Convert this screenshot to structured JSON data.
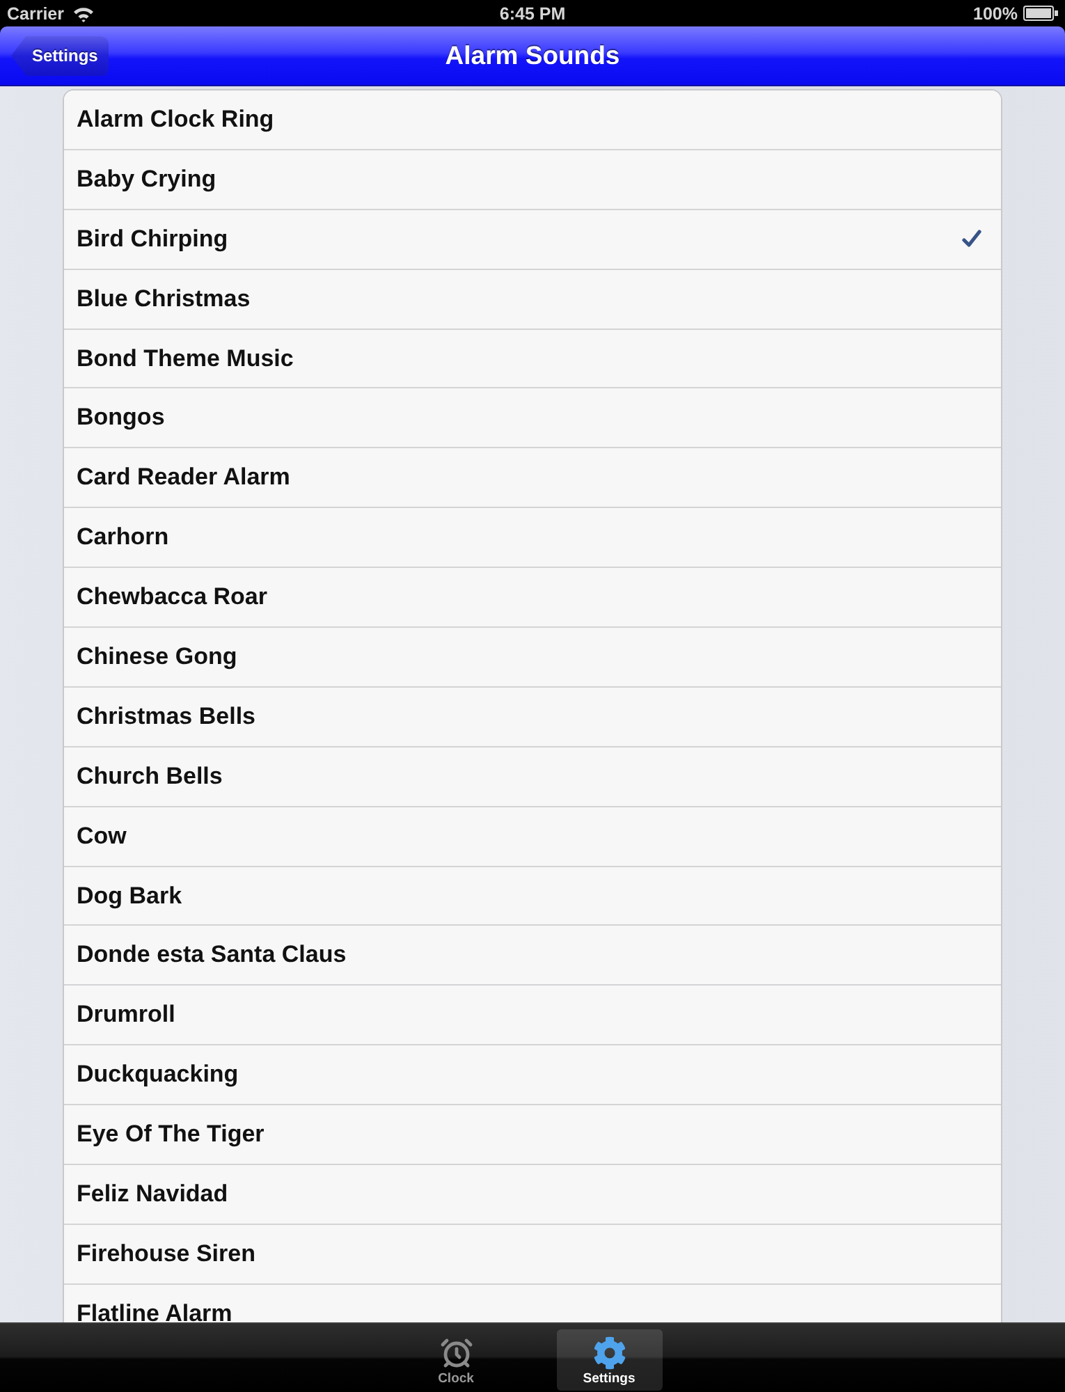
{
  "status_bar": {
    "carrier": "Carrier",
    "time": "6:45 PM",
    "battery": "100%"
  },
  "nav_bar": {
    "back_button": "Settings",
    "title": "Alarm Sounds"
  },
  "sounds": [
    {
      "name": "Alarm Clock Ring",
      "selected": false
    },
    {
      "name": "Baby Crying",
      "selected": false
    },
    {
      "name": "Bird Chirping",
      "selected": true
    },
    {
      "name": "Blue Christmas",
      "selected": false
    },
    {
      "name": "Bond Theme Music",
      "selected": false
    },
    {
      "name": "Bongos",
      "selected": false
    },
    {
      "name": "Card Reader Alarm",
      "selected": false
    },
    {
      "name": "Carhorn",
      "selected": false
    },
    {
      "name": "Chewbacca Roar",
      "selected": false
    },
    {
      "name": "Chinese Gong",
      "selected": false
    },
    {
      "name": "Christmas Bells",
      "selected": false
    },
    {
      "name": "Church Bells",
      "selected": false
    },
    {
      "name": "Cow",
      "selected": false
    },
    {
      "name": "Dog Bark",
      "selected": false
    },
    {
      "name": "Donde esta Santa Claus",
      "selected": false
    },
    {
      "name": "Drumroll",
      "selected": false
    },
    {
      "name": "Duckquacking",
      "selected": false
    },
    {
      "name": "Eye Of The Tiger",
      "selected": false
    },
    {
      "name": "Feliz Navidad",
      "selected": false
    },
    {
      "name": "Firehouse Siren",
      "selected": false
    },
    {
      "name": "Flatline Alarm",
      "selected": false
    }
  ],
  "tab_bar": [
    {
      "label": "Clock",
      "kind": "clock",
      "selected": false
    },
    {
      "label": "Settings",
      "kind": "gear",
      "selected": true
    }
  ]
}
